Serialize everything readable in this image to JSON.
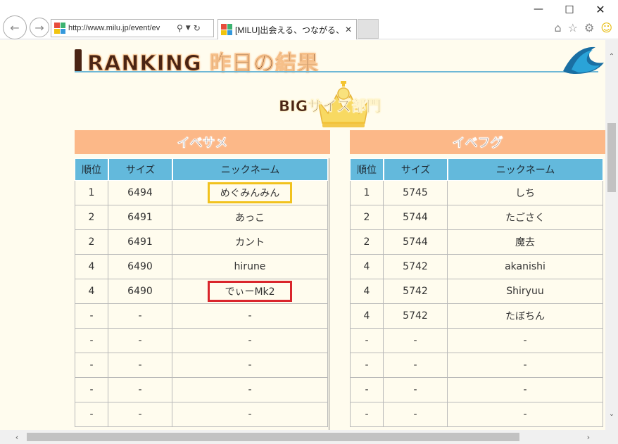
{
  "browser": {
    "address_url": "http://www.milu.jp/event/ev",
    "tab_title": "[MILU]出会える、つながる、楽...",
    "colors": {
      "favicon": [
        "#e74c3c",
        "#3cb371",
        "#f1c40f",
        "#3498db"
      ]
    }
  },
  "page": {
    "ranking_title": "RANKING 昨日の結果",
    "section_title": "BIGサイズ部門",
    "groups": [
      {
        "title": "イベサメ",
        "headers": [
          "順位",
          "サイズ",
          "ニックネーム"
        ],
        "rows": [
          {
            "rank": "1",
            "size": "6494",
            "name": "めぐみんみん",
            "highlight": "yellow"
          },
          {
            "rank": "2",
            "size": "6491",
            "name": "あっこ",
            "highlight": ""
          },
          {
            "rank": "2",
            "size": "6491",
            "name": "カント",
            "highlight": ""
          },
          {
            "rank": "4",
            "size": "6490",
            "name": "hirune",
            "highlight": ""
          },
          {
            "rank": "4",
            "size": "6490",
            "name": "でぃーMk2",
            "highlight": "red"
          },
          {
            "rank": "-",
            "size": "-",
            "name": "-",
            "highlight": ""
          },
          {
            "rank": "-",
            "size": "-",
            "name": "-",
            "highlight": ""
          },
          {
            "rank": "-",
            "size": "-",
            "name": "-",
            "highlight": ""
          },
          {
            "rank": "-",
            "size": "-",
            "name": "-",
            "highlight": ""
          },
          {
            "rank": "-",
            "size": "-",
            "name": "-",
            "highlight": ""
          }
        ]
      },
      {
        "title": "イベフグ",
        "headers": [
          "順位",
          "サイズ",
          "ニックネーム"
        ],
        "rows": [
          {
            "rank": "1",
            "size": "5745",
            "name": "しち",
            "highlight": ""
          },
          {
            "rank": "2",
            "size": "5744",
            "name": "たごさく",
            "highlight": ""
          },
          {
            "rank": "2",
            "size": "5744",
            "name": "魔去",
            "highlight": ""
          },
          {
            "rank": "4",
            "size": "5742",
            "name": "akanishi",
            "highlight": ""
          },
          {
            "rank": "4",
            "size": "5742",
            "name": "Shiryuu",
            "highlight": ""
          },
          {
            "rank": "4",
            "size": "5742",
            "name": "たぼちん",
            "highlight": ""
          },
          {
            "rank": "-",
            "size": "-",
            "name": "-",
            "highlight": ""
          },
          {
            "rank": "-",
            "size": "-",
            "name": "-",
            "highlight": ""
          },
          {
            "rank": "-",
            "size": "-",
            "name": "-",
            "highlight": ""
          },
          {
            "rank": "-",
            "size": "-",
            "name": "-",
            "highlight": ""
          }
        ]
      }
    ]
  }
}
